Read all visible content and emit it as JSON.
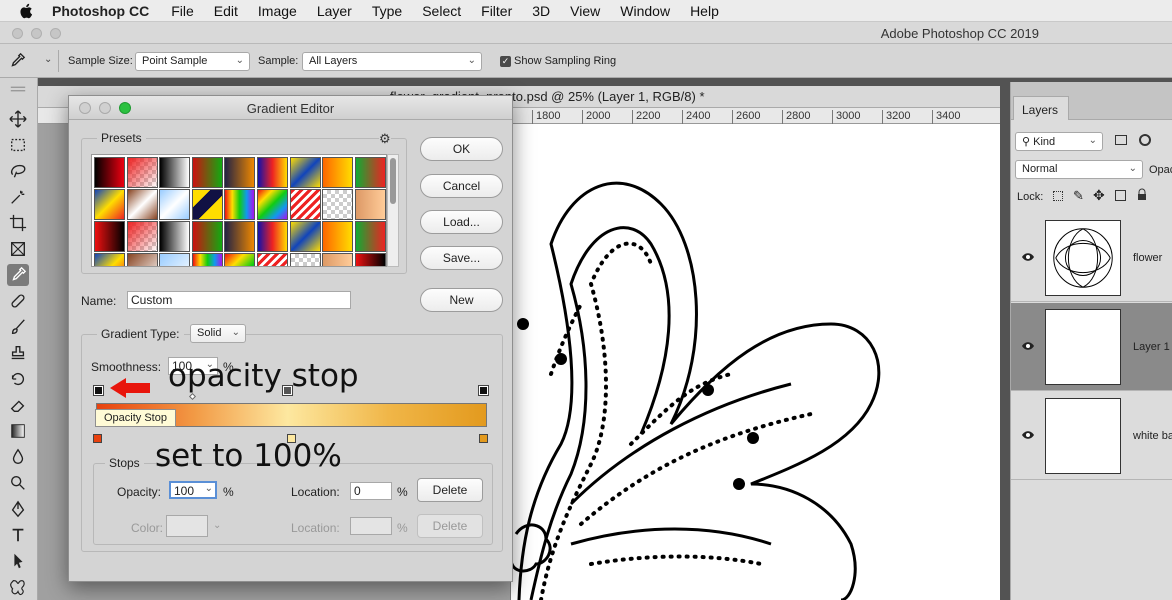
{
  "menubar": {
    "app": "Photoshop CC",
    "items": [
      "File",
      "Edit",
      "Image",
      "Layer",
      "Type",
      "Select",
      "Filter",
      "3D",
      "View",
      "Window",
      "Help"
    ]
  },
  "app_title": "Adobe Photoshop CC 2019",
  "options": {
    "sample_size_label": "Sample Size:",
    "sample_size_value": "Point Sample",
    "sample_label": "Sample:",
    "sample_value": "All Layers",
    "show_ring_label": "Show Sampling Ring",
    "show_ring_checked": true
  },
  "document": {
    "title": "flower_gradient_pronto.psd @ 25% (Layer 1, RGB/8) *",
    "ruler_ticks": [
      "1800",
      "2000",
      "2200",
      "2400",
      "2600",
      "2800",
      "3000",
      "3200",
      "3400"
    ]
  },
  "layers_panel": {
    "tab": "Layers",
    "filter_value": "Kind",
    "blend_mode": "Normal",
    "opacity_label": "Opac",
    "lock_label": "Lock:",
    "layers": [
      {
        "name": "flower",
        "selected": false
      },
      {
        "name": "Layer 1",
        "selected": true
      },
      {
        "name": "white ba",
        "selected": false
      }
    ]
  },
  "gradient_editor": {
    "title": "Gradient Editor",
    "presets_label": "Presets",
    "buttons": {
      "ok": "OK",
      "cancel": "Cancel",
      "load": "Load...",
      "save": "Save...",
      "new": "New"
    },
    "name_label": "Name:",
    "name_value": "Custom",
    "gradient_type_label": "Gradient Type:",
    "gradient_type_value": "Solid",
    "smoothness_label": "Smoothness:",
    "smoothness_value": "100",
    "percent": "%",
    "stops_label": "Stops",
    "opacity_label": "Opacity:",
    "opacity_value": "100",
    "location_label": "Location:",
    "location_value": "0",
    "color_label": "Color:",
    "delete_label": "Delete",
    "tooltip": "Opacity Stop",
    "gradient_colors": [
      "#e8410e",
      "#f29a45",
      "#fde8a0",
      "#f0b648",
      "#e39a1e"
    ]
  },
  "annotations": {
    "top": "opacity stop",
    "bottom": "set to 100%",
    "arrow_color": "#e8160c"
  }
}
